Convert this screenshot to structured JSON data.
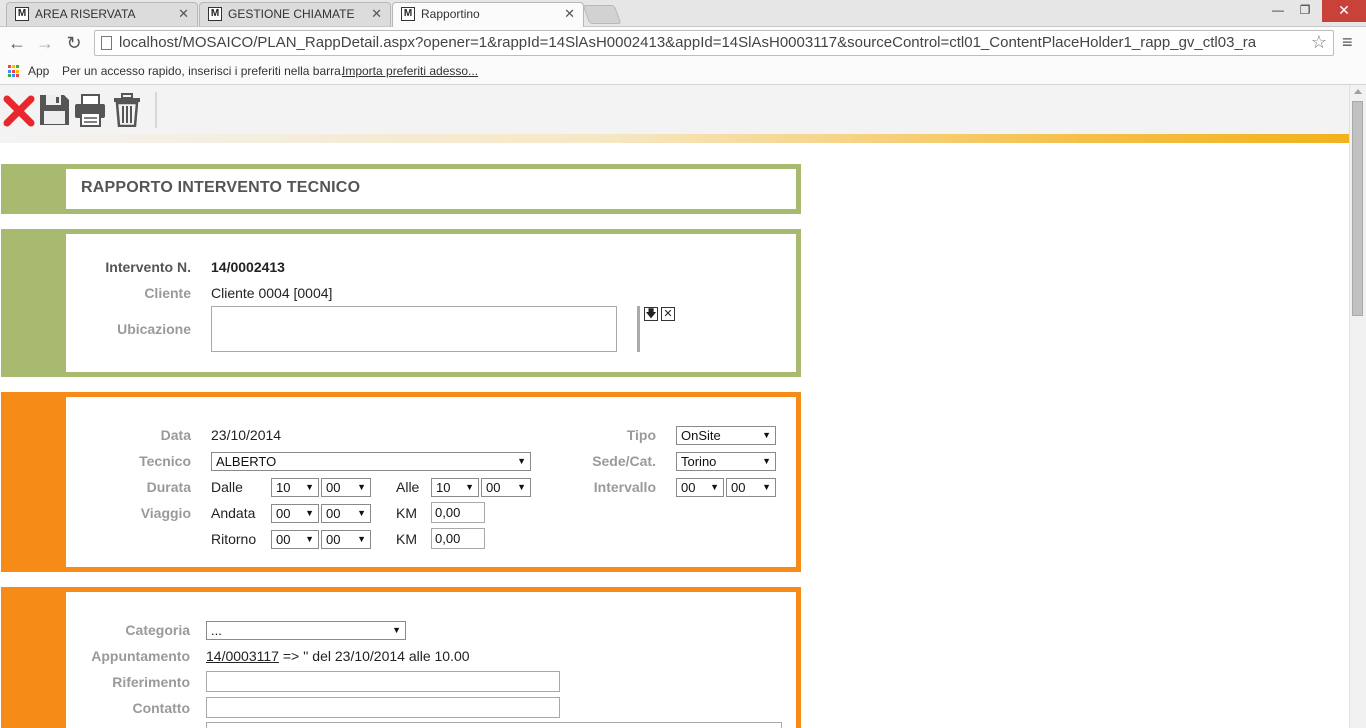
{
  "browser": {
    "tabs": [
      {
        "title": "AREA RISERVATA",
        "icon": "mosaico-favicon",
        "active": false
      },
      {
        "title": "GESTIONE CHIAMATE",
        "icon": "mosaico-favicon",
        "active": false
      },
      {
        "title": "Rapportino",
        "icon": "mosaico-favicon",
        "active": true
      }
    ],
    "url": "localhost/MOSAICO/PLAN_RappDetail.aspx?opener=1&rappId=14SlAsH0002413&appId=14SlAsH0003117&sourceControl=ctl01_ContentPlaceHolder1_rapp_gv_ctl03_ra",
    "bookmarks": {
      "apps_label": "App",
      "hint": "Per un accesso rapido, inserisci i preferiti nella barra.",
      "import_link": "Importa preferiti adesso..."
    }
  },
  "toolbar": {
    "icons": [
      "close-icon",
      "save-icon",
      "print-icon",
      "trash-icon"
    ],
    "accent_colors": {
      "close": "#e8262b",
      "icons": "#555555",
      "gradient_end": "#f2b21c"
    }
  },
  "report": {
    "title": "RAPPORTO INTERVENTO TECNICO",
    "header": {
      "intervento_label": "Intervento N.",
      "intervento_value": "14/0002413",
      "cliente_label": "Cliente",
      "cliente_value": "Cliente 0004 [0004]",
      "ubicazione_label": "Ubicazione",
      "ubicazione_value": ""
    },
    "details": {
      "data_label": "Data",
      "data_value": "23/10/2014",
      "tecnico_label": "Tecnico",
      "tecnico_value": "ALBERTO",
      "durata_label": "Durata",
      "dalle_label": "Dalle",
      "dalle_h": "10",
      "dalle_m": "00",
      "alle_label": "Alle",
      "alle_h": "10",
      "alle_m": "00",
      "viaggio_label": "Viaggio",
      "andata_label": "Andata",
      "andata_h": "00",
      "andata_m": "00",
      "km_label": "KM",
      "andata_km": "0,00",
      "ritorno_label": "Ritorno",
      "ritorno_h": "00",
      "ritorno_m": "00",
      "ritorno_km": "0,00",
      "tipo_label": "Tipo",
      "tipo_value": "OnSite",
      "sede_label": "Sede/Cat.",
      "sede_value": "Torino",
      "intervallo_label": "Intervallo",
      "intervallo_h": "00",
      "intervallo_m": "00"
    },
    "extra": {
      "categoria_label": "Categoria",
      "categoria_value": "...",
      "appuntamento_label": "Appuntamento",
      "appuntamento_link": "14/0003117",
      "appuntamento_text": "=> '' del 23/10/2014 alle 10.00",
      "riferimento_label": "Riferimento",
      "riferimento_value": "",
      "contatto_label": "Contatto",
      "contatto_value": ""
    }
  }
}
